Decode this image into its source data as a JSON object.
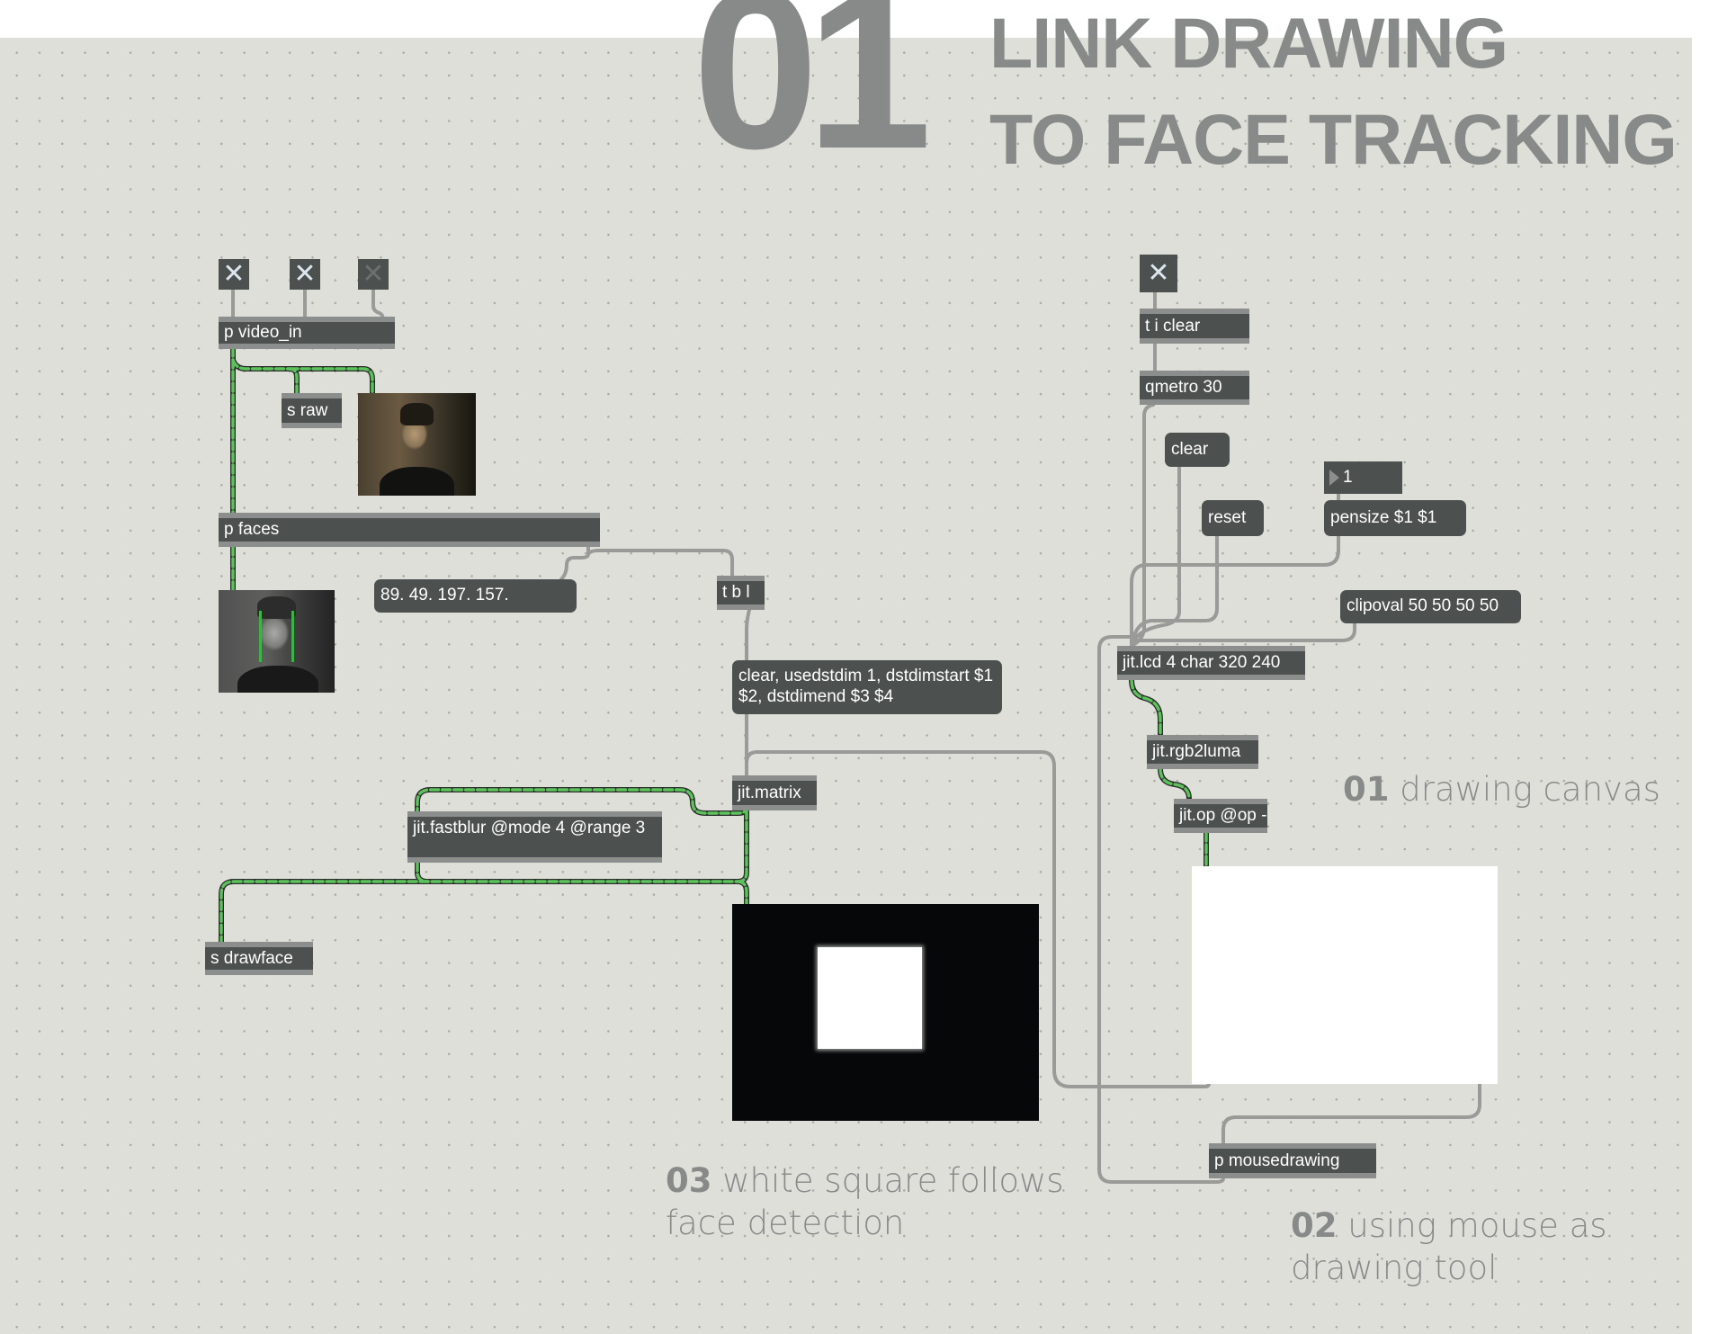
{
  "header": {
    "number": "01",
    "title_line1": "LINK DRAWING",
    "title_line2": "TO FACE TRACKING"
  },
  "colors": {
    "canvas_bg": "#dfdfda",
    "object_bg": "#4c504f",
    "object_border": "#8c8e8d",
    "title_gray": "#888a89",
    "matrix_cord": "#4fbf4f",
    "message_cord": "#9a9b99"
  },
  "left_patch": {
    "toggles": [
      {
        "icon": "toggle-x-icon",
        "state": "on"
      },
      {
        "icon": "toggle-x-icon",
        "state": "on"
      },
      {
        "icon": "toggle-x-icon",
        "state": "off"
      }
    ],
    "video_in": "p video_in",
    "send_raw": "s raw",
    "faces": "p faces",
    "face_coords": "89. 49. 197. 157.",
    "trigger": "t b l",
    "dim_message": "clear, usedstdim 1, dstdimstart $1 $2, dstdimend $3 $4",
    "matrix": "jit.matrix",
    "fastblur": "jit.fastblur @mode 4 @range 3",
    "send_drawface": "s drawface"
  },
  "right_patch": {
    "toggle": {
      "icon": "toggle-x-icon",
      "state": "on"
    },
    "trigger_clear": "t i clear",
    "qmetro": "qmetro 30",
    "clear_msg": "clear",
    "reset_msg": "reset",
    "pensize_number": "1",
    "pensize_msg": "pensize $1 $1",
    "clipoval_msg": "clipoval 50 50 50 50",
    "lcd": "jit.lcd 4 char 320 240",
    "rgb2luma": "jit.rgb2luma",
    "op": "jit.op @op -",
    "mousedrawing": "p mousedrawing"
  },
  "notes": {
    "n01_num": "01",
    "n01_text": "drawing canvas",
    "n02_num": "02",
    "n02_text": "using mouse as drawing tool",
    "n03_num": "03",
    "n03_text": "white square follows face detection"
  }
}
